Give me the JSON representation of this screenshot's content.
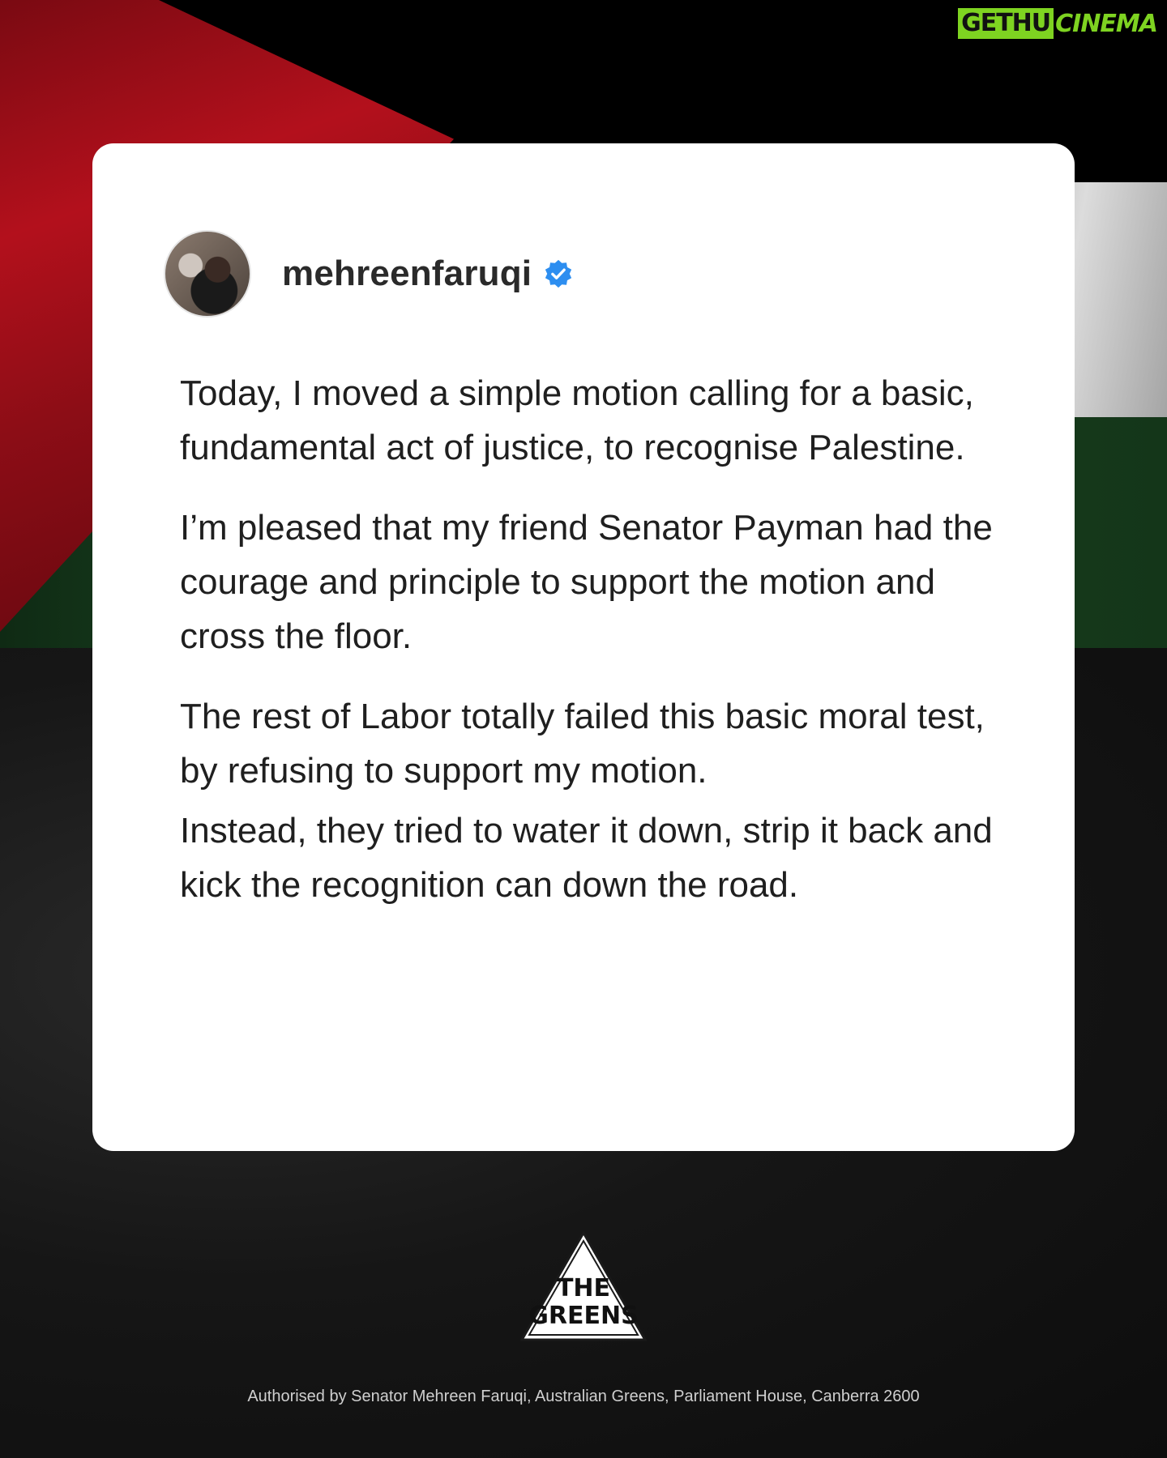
{
  "watermark": {
    "part1": "GETHU",
    "part2": "CINEMA"
  },
  "post": {
    "username": "mehreenfaruqi",
    "verified_icon": "verified-badge-icon",
    "paragraphs": [
      "Today, I moved a simple motion calling for a basic, fundamental act of justice, to recognise Palestine.",
      "I’m pleased that my friend Senator Payman had the courage and principle to support the motion and cross the floor.",
      "The rest of Labor totally failed this basic moral test, by refusing to support my motion.",
      "Instead, they tried to water it down, strip it back and kick the recognition can down the road."
    ]
  },
  "logo": {
    "line1": "THE",
    "line2": "GREENS"
  },
  "footer": {
    "authorisation": "Authorised by Senator Mehreen Faruqi, Australian Greens, Parliament House, Canberra 2600"
  },
  "colors": {
    "flag_red": "#b3101c",
    "flag_green": "#1d4a23",
    "verified_blue": "#2d8ef0",
    "watermark_green": "#7ed321"
  }
}
